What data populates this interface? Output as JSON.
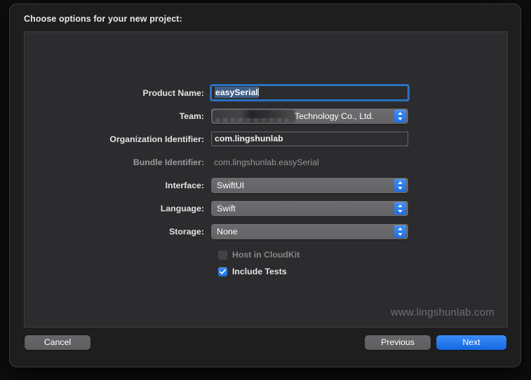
{
  "dialog": {
    "title": "Choose options for your new project:"
  },
  "form": {
    "fields": [
      {
        "label": "Product Name:",
        "type": "textfield",
        "value": "easySerial",
        "focused": true,
        "selected": true
      },
      {
        "label": "Team:",
        "type": "popup",
        "value": "Technology Co., Ltd.",
        "redacted_prefix": true
      },
      {
        "label": "Organization Identifier:",
        "type": "textfield",
        "value": "com.lingshunlab",
        "focused": false
      },
      {
        "label": "Bundle Identifier:",
        "type": "readonly",
        "value": "com.lingshunlab.easySerial"
      },
      {
        "label": "Interface:",
        "type": "popup",
        "value": "SwiftUI"
      },
      {
        "label": "Language:",
        "type": "popup",
        "value": "Swift"
      },
      {
        "label": "Storage:",
        "type": "popup",
        "value": "None"
      }
    ],
    "checkboxes": [
      {
        "label": "Host in CloudKit",
        "checked": false,
        "disabled": true
      },
      {
        "label": "Include Tests",
        "checked": true,
        "disabled": false
      }
    ]
  },
  "watermark": "www.lingshunlab.com",
  "buttons": {
    "cancel": "Cancel",
    "previous": "Previous",
    "next": "Next"
  },
  "colors": {
    "accent_blue": "#1f6fe0",
    "window_bg": "#1e1e1f",
    "panel_bg": "#2c2c2e",
    "focus_ring": "#2f7fd1",
    "selection": "#3f5f86",
    "label_text": "#e4e4e6",
    "disabled_text": "#88888b",
    "watermark_text": "#6f6f73"
  }
}
